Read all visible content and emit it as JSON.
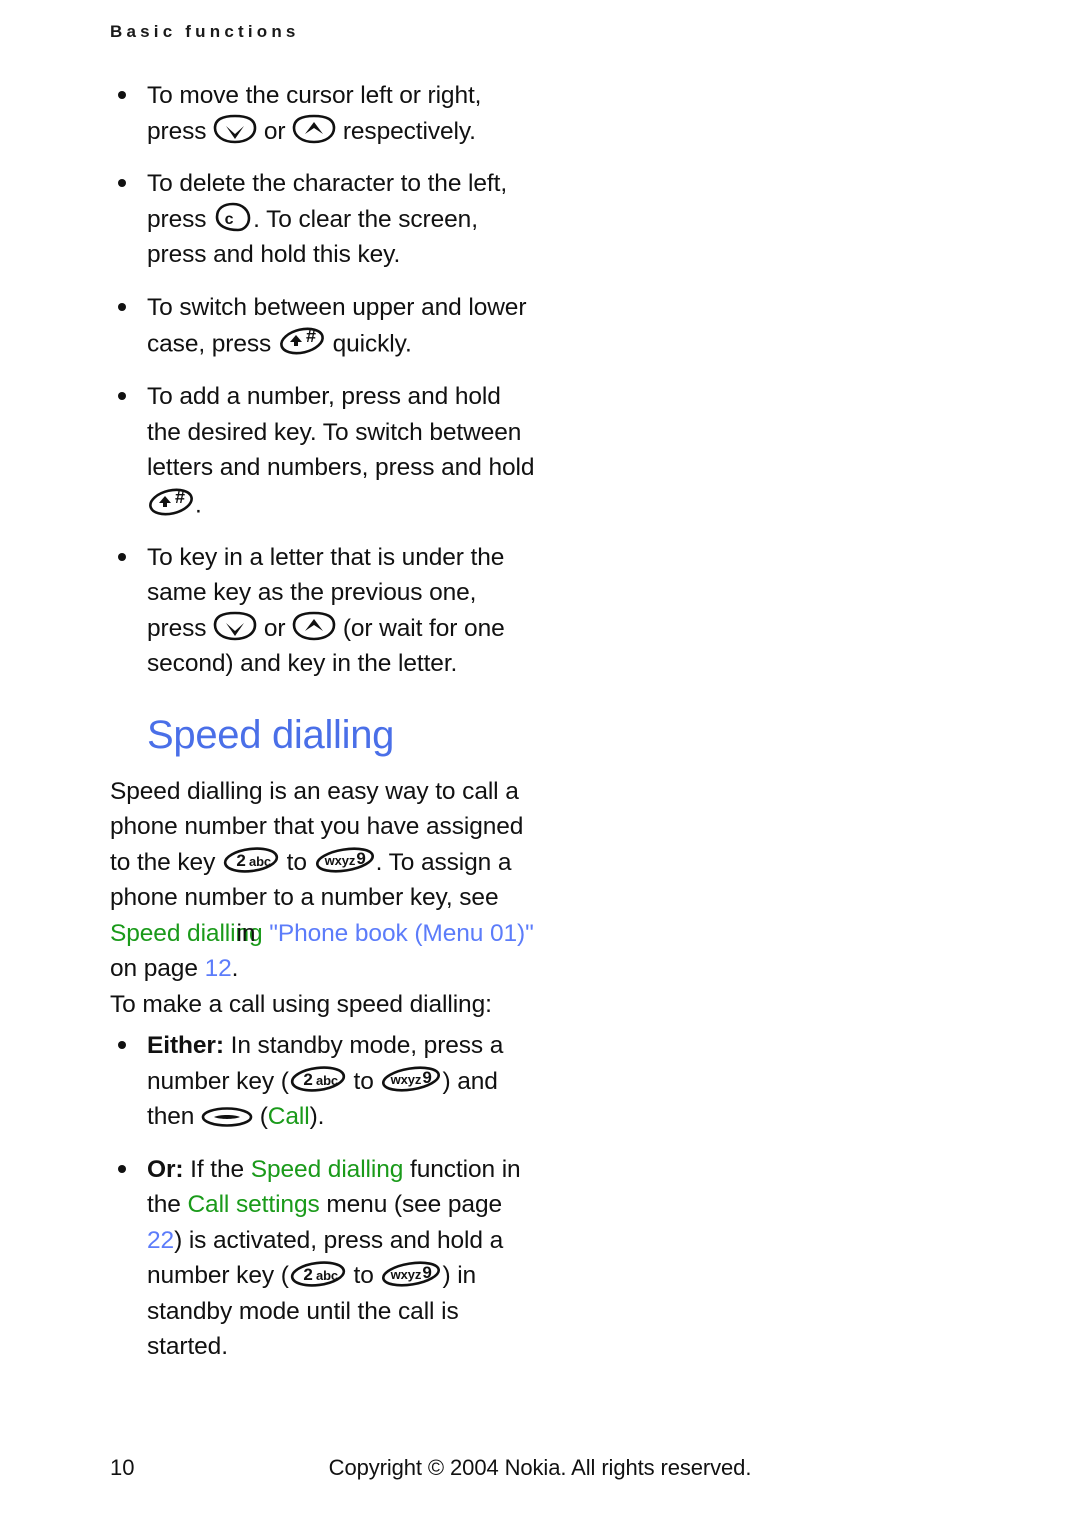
{
  "header": {
    "running_head": "Basic functions"
  },
  "intro_bullets": [
    {
      "id": "move-cursor",
      "parts": [
        {
          "type": "text",
          "value": "To move the cursor left or right, press "
        },
        {
          "type": "key",
          "icon": "scroll-down-key",
          "label": "scroll down"
        },
        {
          "type": "text",
          "value": " or "
        },
        {
          "type": "key",
          "icon": "scroll-up-key",
          "label": "scroll up"
        },
        {
          "type": "text",
          "value": " respectively."
        }
      ]
    },
    {
      "id": "delete-character",
      "parts": [
        {
          "type": "text",
          "value": "To delete the character to the left, press "
        },
        {
          "type": "key",
          "icon": "clear-key",
          "label": "c"
        },
        {
          "type": "text",
          "value": ". To clear the screen, press and hold this key."
        }
      ]
    },
    {
      "id": "switch-case",
      "parts": [
        {
          "type": "text",
          "value": "To switch between upper and lower case, press "
        },
        {
          "type": "key",
          "icon": "shift-hash-key",
          "label": "shift hash"
        },
        {
          "type": "text",
          "value": " quickly."
        }
      ]
    },
    {
      "id": "add-number",
      "parts": [
        {
          "type": "text",
          "value": "To add a number, press and hold the desired key. To switch between letters and numbers, press and hold "
        },
        {
          "type": "key",
          "icon": "shift-hash-key",
          "label": "shift hash"
        },
        {
          "type": "text",
          "value": "."
        }
      ]
    },
    {
      "id": "key-in-letter",
      "parts": [
        {
          "type": "text",
          "value": "To key in a letter that is under the same key as the previous one, press "
        },
        {
          "type": "key",
          "icon": "scroll-down-key",
          "label": "scroll down"
        },
        {
          "type": "text",
          "value": " or "
        },
        {
          "type": "key",
          "icon": "scroll-up-key",
          "label": "scroll up"
        },
        {
          "type": "text",
          "value": " (or wait for one second) and key in the letter."
        }
      ]
    }
  ],
  "speed_dialling": {
    "title": "Speed dialling",
    "title_color": "#4a6fe8",
    "intro_parts": [
      {
        "type": "text",
        "value": "Speed dialling is an easy way to call a phone number that you have assigned to the key "
      },
      {
        "type": "key",
        "icon": "key-2abc",
        "label": "2abc"
      },
      {
        "type": "text",
        "value": " to "
      },
      {
        "type": "key",
        "icon": "key-wxyz9",
        "label": "wxyz9"
      },
      {
        "type": "text",
        "value": ". To assign a phone number to a number key, see "
      },
      {
        "type": "green",
        "value": "Speed dialling"
      },
      {
        "type": "overlap",
        "value": "in"
      },
      {
        "type": "blue",
        "value": " \"Phone book (Menu 01)\""
      },
      {
        "type": "text",
        "value": " on page "
      },
      {
        "type": "blue",
        "value": "12"
      },
      {
        "type": "text",
        "value": "."
      }
    ],
    "lead_in": "To make a call using speed dialling:",
    "method_bullets": [
      {
        "id": "either",
        "parts": [
          {
            "type": "bold",
            "value": "Either:"
          },
          {
            "type": "text",
            "value": " In standby mode, press a number key ("
          },
          {
            "type": "key",
            "icon": "key-2abc",
            "label": "2abc"
          },
          {
            "type": "text",
            "value": " to "
          },
          {
            "type": "key",
            "icon": "key-wxyz9",
            "label": "wxyz9"
          },
          {
            "type": "text",
            "value": ") and then "
          },
          {
            "type": "key",
            "icon": "soft-key",
            "label": "soft key"
          },
          {
            "type": "text",
            "value": " ("
          },
          {
            "type": "green",
            "value": "Call"
          },
          {
            "type": "text",
            "value": ")."
          }
        ]
      },
      {
        "id": "or",
        "parts": [
          {
            "type": "bold",
            "value": "Or:"
          },
          {
            "type": "text",
            "value": "  If the "
          },
          {
            "type": "green",
            "value": "Speed dialling"
          },
          {
            "type": "text",
            "value": " function in the "
          },
          {
            "type": "green",
            "value": "Call settings"
          },
          {
            "type": "text",
            "value": " menu (see page "
          },
          {
            "type": "blue",
            "value": "22"
          },
          {
            "type": "text",
            "value": ") is activated, press and hold a number key ("
          },
          {
            "type": "key",
            "icon": "key-2abc",
            "label": "2abc"
          },
          {
            "type": "text",
            "value": " to "
          },
          {
            "type": "key",
            "icon": "key-wxyz9",
            "label": "wxyz9"
          },
          {
            "type": "text",
            "value": ") in standby mode until the call is started."
          }
        ]
      }
    ]
  },
  "footer": {
    "page_number": "10",
    "copyright": "Copyright © 2004 Nokia. All rights reserved."
  },
  "colors": {
    "heading_blue": "#4a6fe8",
    "link_blue": "#5c7cfa",
    "ui_green": "#1a9a1a",
    "text_black": "#111111"
  }
}
